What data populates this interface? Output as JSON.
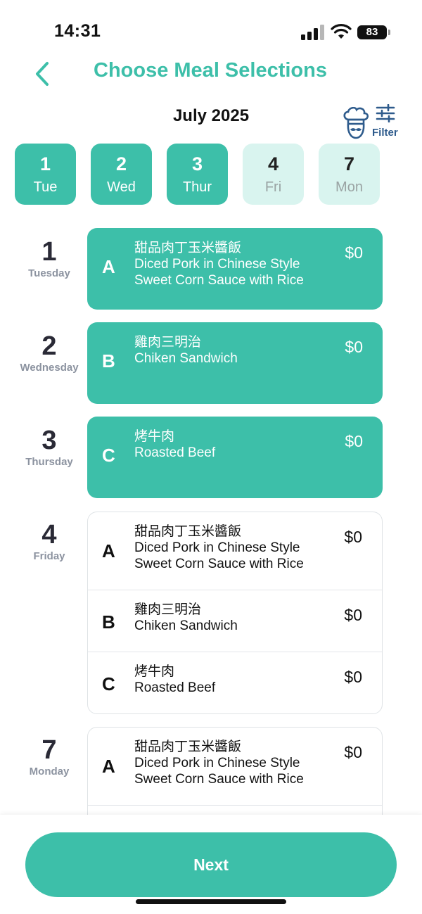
{
  "status_bar": {
    "time": "14:31",
    "battery": "83"
  },
  "header": {
    "title": "Choose Meal Selections",
    "back_icon": "chevron-left-icon"
  },
  "calendar": {
    "month": "July 2025",
    "filter_label": "Filter",
    "chef_icon": "chef-icon",
    "filter_icon": "sliders-icon"
  },
  "date_tabs": [
    {
      "num": "1",
      "dow": "Tue",
      "selected": true
    },
    {
      "num": "2",
      "dow": "Wed",
      "selected": true
    },
    {
      "num": "3",
      "dow": "Thur",
      "selected": true
    },
    {
      "num": "4",
      "dow": "Fri",
      "selected": false
    },
    {
      "num": "7",
      "dow": "Mon",
      "selected": false
    }
  ],
  "days": [
    {
      "num": "1",
      "name": "Tuesday",
      "selected": {
        "letter": "A",
        "zh": "甜品肉丁玉米醬飯",
        "en1": "Diced Pork in Chinese Style",
        "en2": "Sweet Corn Sauce with Rice",
        "price": "$0"
      }
    },
    {
      "num": "2",
      "name": "Wednesday",
      "selected": {
        "letter": "B",
        "zh": "雞肉三明治",
        "en1": "Chiken Sandwich",
        "price": "$0"
      }
    },
    {
      "num": "3",
      "name": "Thursday",
      "selected": {
        "letter": "C",
        "zh": "烤牛肉",
        "en1": "Roasted Beef",
        "price": "$0"
      }
    },
    {
      "num": "4",
      "name": "Friday",
      "options": [
        {
          "letter": "A",
          "zh": "甜品肉丁玉米醬飯",
          "en1": "Diced Pork in Chinese Style",
          "en2": "Sweet Corn Sauce with Rice",
          "price": "$0"
        },
        {
          "letter": "B",
          "zh": "雞肉三明治",
          "en1": "Chiken Sandwich",
          "price": "$0"
        },
        {
          "letter": "C",
          "zh": "烤牛肉",
          "en1": "Roasted Beef",
          "price": "$0"
        }
      ]
    },
    {
      "num": "7",
      "name": "Monday",
      "options": [
        {
          "letter": "A",
          "zh": "甜品肉丁玉米醬飯",
          "en1": "Diced Pork in Chinese Style",
          "en2": "Sweet Corn Sauce with Rice",
          "price": "$0"
        }
      ]
    }
  ],
  "footer": {
    "next_label": "Next"
  },
  "colors": {
    "accent": "#3dbfa9",
    "accent_light": "#d9f4ef",
    "filter_blue": "#2e5b8c"
  }
}
